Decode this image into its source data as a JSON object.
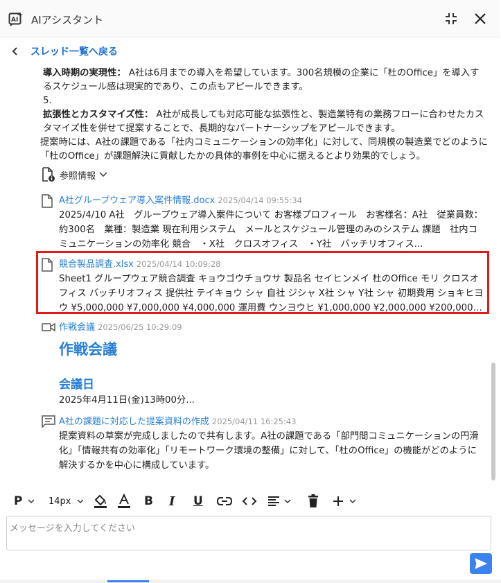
{
  "header": {
    "title": "AIアシスタント"
  },
  "nav": {
    "back_label": "スレッド一覧へ戻る"
  },
  "message": {
    "item1_heading": "導入時期の実現性：",
    "item1_text": "A社は6月までの導入を希望しています。300名規模の企業に「杜のOffice」を導入するスケジュール感は現実的であり、この点もアピールできます。",
    "item5_number": "5.",
    "item5_heading": "拡張性とカスタマイズ性：",
    "item5_text": "A社が成長しても対応可能な拡張性と、製造業特有の業務フローに合わせたカスタマイズ性を併せて提案することで、長期的なパートナーシップをアピールできます。",
    "closing": "提案時には、A社の課題である「社内コミュニケーションの効率化」に対して、同規模の製造業でどのように「杜のOffice」が課題解決に貢献したかの具体的事例を中心に据えるとより効果的でしょう。"
  },
  "references": {
    "toggle_label": "参照情報",
    "items": [
      {
        "title": "A社グループウェア導入案件情報.docx",
        "date": "2025/04/14 09:55:34",
        "body": "2025/4/10 A社　グループウェア導入案件について お客様プロフィール　お客様名：A社　従業員数：約300名　業種：製造業 現在利用システム　メールとスケジュール管理のみのシステム 課題　社内コミュニケーションの効率化 競合　・X社　クロスオフィス　・Y社　バッチリオフィス..."
      },
      {
        "title": "競合製品調査.xlsx",
        "date": "2025/04/14 10:09:28",
        "body": "Sheet1 グループウェア競合調査 キョウゴウチョウサ 製品名 セイヒンメイ 杜のOffice モリ クロスオフィス バッチリオフィス 提供社 テイキョウ シャ 自社 ジシャ X社 シャ Y社 シャ 初期費用 ショキヒヨウ ¥5,000,000 ¥7,000,000 ¥4,000,000 運用費 ウンヨウヒ ¥1,000,000 ¥2,000,000 ¥200,000 特..."
      },
      {
        "title": "作戦会議",
        "date": "2025/06/25 10:29:09",
        "heading1": "作戦会議",
        "heading2": "会議日",
        "body": "2025年4月11日(金)13時00分..."
      },
      {
        "title": "A社の課題に対応した提案資料の作成",
        "date": "2025/04/11 16:25:43",
        "body": "提案資料の草案が完成しましたので共有します。A社の課題である「部門間コミュニケーションの円滑化」「情報共有の効率化」「リモートワーク環境の整備」に対して、「杜のOffice」の機能がどのように解決するかを中心に構成しています。"
      }
    ]
  },
  "toolbar": {
    "paragraph_label": "P",
    "font_size": "14px"
  },
  "composer": {
    "placeholder": "メッセージを入力してください"
  },
  "colors": {
    "accent": "#2a7fd4",
    "highlight": "#e01919",
    "send": "#3b82f0"
  }
}
